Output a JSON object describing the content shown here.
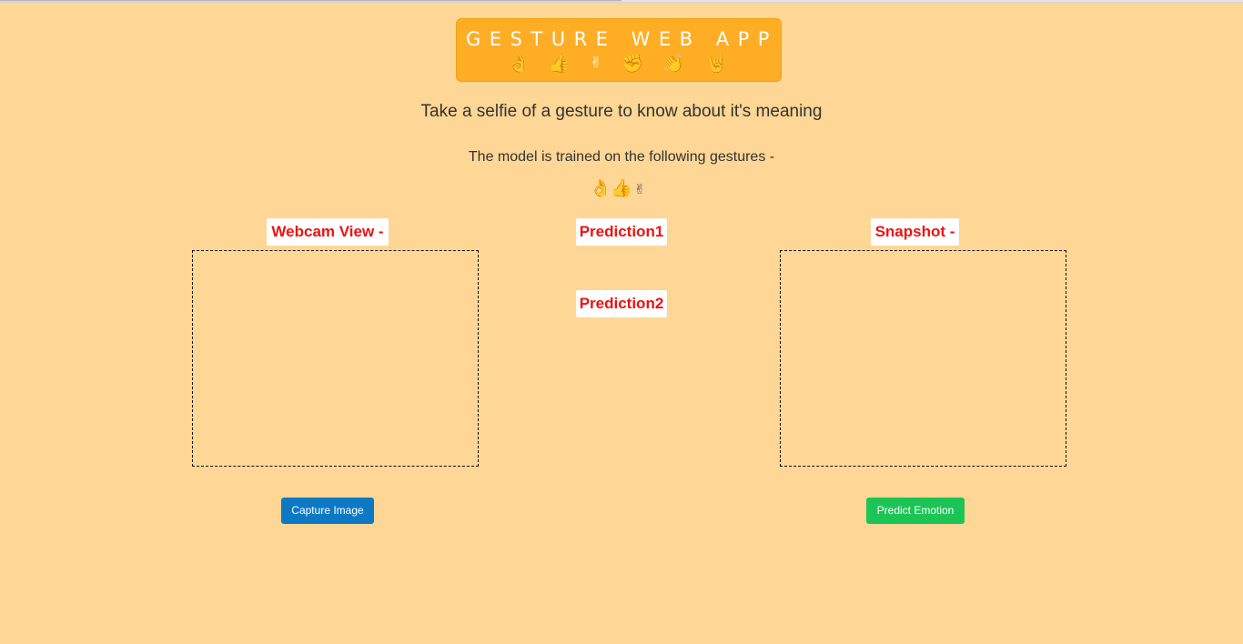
{
  "header": {
    "title": "GESTURE WEB APP",
    "emojis": [
      {
        "name": "ok-hand-icon",
        "glyph": "👌"
      },
      {
        "name": "thumbs-up-icon",
        "glyph": "👍"
      },
      {
        "name": "victory-hand-icon",
        "glyph": "✌"
      },
      {
        "name": "raised-fist-icon",
        "glyph": "✊"
      },
      {
        "name": "clapping-hands-icon",
        "glyph": "👏"
      },
      {
        "name": "rock-on-icon",
        "glyph": "🤘"
      }
    ]
  },
  "subtitle": "Take a selfie of a gesture to know about it's meaning",
  "trained_text": "The model is trained on the following gestures -",
  "trained_gestures": [
    {
      "name": "ok-hand-icon",
      "glyph": "👌"
    },
    {
      "name": "thumbs-up-icon",
      "glyph": "👍"
    },
    {
      "name": "victory-hand-icon",
      "glyph": "✌"
    }
  ],
  "webcam": {
    "label": "Webcam View -",
    "button": "Capture Image"
  },
  "predictions": {
    "first": "Prediction1",
    "second": "Prediction2"
  },
  "snapshot": {
    "label": "Snapshot -",
    "button": "Predict Emotion"
  },
  "colors": {
    "background": "#fed695",
    "title_box": "#ffad25",
    "label_text": "#ee1111",
    "capture_button": "#0d79c5",
    "predict_button": "#1cc456"
  }
}
